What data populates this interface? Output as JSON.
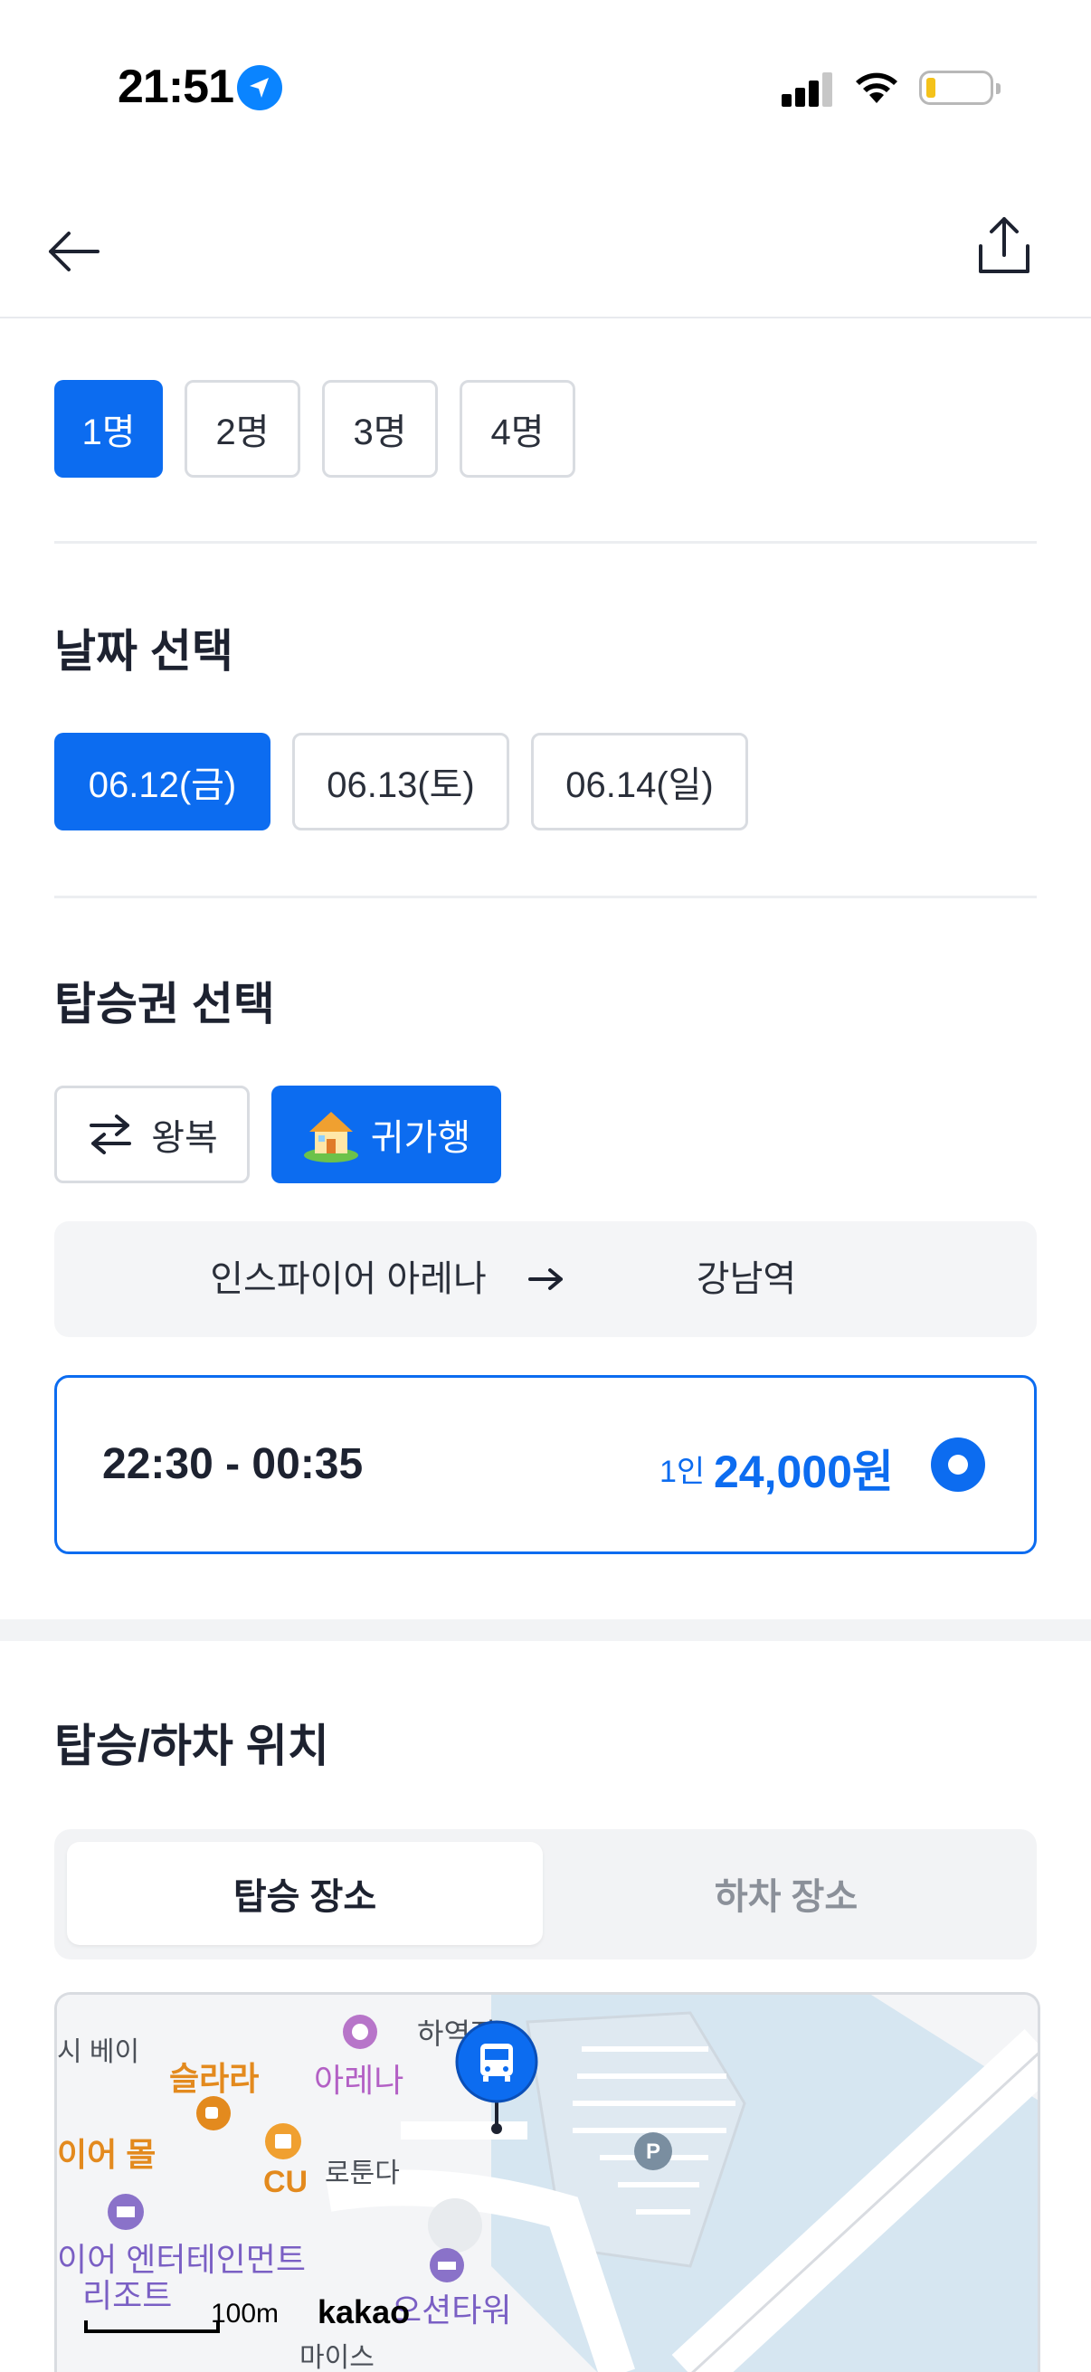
{
  "status_bar": {
    "time": "21:51"
  },
  "party_size": {
    "options": [
      {
        "label": "1명",
        "selected": true
      },
      {
        "label": "2명",
        "selected": false
      },
      {
        "label": "3명",
        "selected": false
      },
      {
        "label": "4명",
        "selected": false
      }
    ]
  },
  "date_section": {
    "title": "날짜 선택",
    "options": [
      {
        "label": "06.12(금)",
        "selected": true
      },
      {
        "label": "06.13(토)",
        "selected": false
      },
      {
        "label": "06.14(일)",
        "selected": false
      }
    ]
  },
  "ticket_section": {
    "title": "탑승권 선택",
    "types": [
      {
        "label": "왕복",
        "icon": "round-trip-arrows-icon",
        "selected": false
      },
      {
        "label": "귀가행",
        "icon": "house-icon",
        "selected": true
      }
    ],
    "route": {
      "from": "인스파이어 아레나",
      "to": "강남역"
    },
    "option": {
      "time": "22:30 - 00:35",
      "per_person": "1인",
      "price": "24,000원",
      "selected": true
    }
  },
  "location_section": {
    "title": "탑승/하차 위치",
    "tabs": [
      {
        "label": "탑승 장소",
        "active": true
      },
      {
        "label": "하차 장소",
        "active": false
      }
    ],
    "map": {
      "labels": {
        "bay": "시 베이",
        "salala": "슬라라",
        "arena": "아레나",
        "hayeok": "하역장",
        "mall": "이어 몰",
        "cu": "CU",
        "rotunda": "로툰다",
        "resort": "이어 엔터테인먼트",
        "resort2": "리조트",
        "ocean": "오션타워",
        "bottom": "마이스"
      },
      "scale": "100m",
      "brand": "kakao"
    }
  },
  "colors": {
    "accent": "#0c6cf0",
    "text": "#1d2230",
    "muted": "#8b9099"
  }
}
